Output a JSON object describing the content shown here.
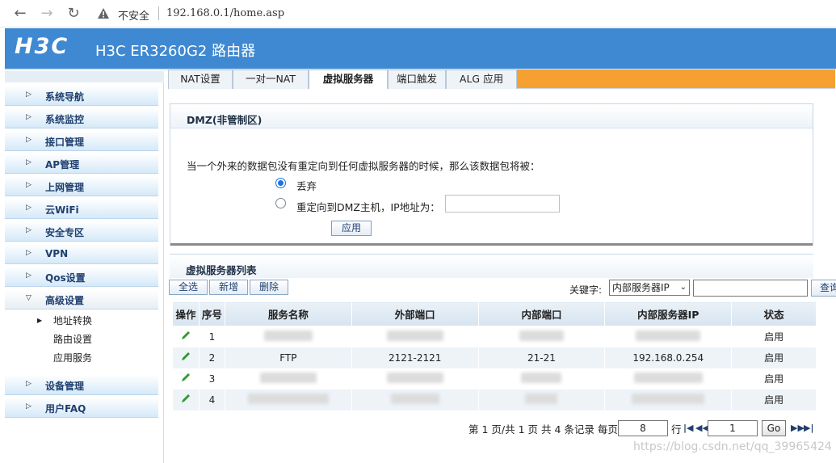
{
  "browser": {
    "back_icon": "back-arrow-icon",
    "forward_icon": "forward-arrow-icon",
    "reload_icon": "reload-icon",
    "insecure_label": "不安全",
    "url": "192.168.0.1/home.asp"
  },
  "header": {
    "logo": "H3C",
    "model": "H3C ER3260G2 路由器",
    "color": "#3f89d2"
  },
  "sidebar": {
    "items": [
      {
        "label": "系统导航"
      },
      {
        "label": "系统监控"
      },
      {
        "label": "接口管理"
      },
      {
        "label": "AP管理"
      },
      {
        "label": "上网管理"
      },
      {
        "label": "云WiFi"
      },
      {
        "label": "安全专区"
      },
      {
        "label": "VPN"
      },
      {
        "label": "Qos设置"
      },
      {
        "label": "高级设置"
      },
      {
        "label": "设备管理"
      },
      {
        "label": "用户FAQ"
      }
    ],
    "sub_items": [
      {
        "label": "地址转换"
      },
      {
        "label": "路由设置"
      },
      {
        "label": "应用服务"
      }
    ]
  },
  "tabs": [
    {
      "label": "NAT设置"
    },
    {
      "label": "一对一NAT"
    },
    {
      "label": "虚拟服务器"
    },
    {
      "label": "端口触发"
    },
    {
      "label": "ALG 应用"
    }
  ],
  "dmz": {
    "title": "DMZ(非管制区)",
    "description": "当一个外来的数据包没有重定向到任何虚拟服务器的时候，那么该数据包将被：",
    "option_drop": "丢弃",
    "option_redirect": "重定向到DMZ主机，IP地址为：",
    "ip_value": "",
    "apply_label": "应用"
  },
  "list": {
    "title": "虚拟服务器列表",
    "select_all": "全选",
    "add": "新增",
    "delete": "删除",
    "keyword_label": "关键字:",
    "keyword_option": "内部服务器IP",
    "keyword_value": "",
    "search_label": "查询",
    "columns": [
      "操作",
      "序号",
      "服务名称",
      "外部端口",
      "内部端口",
      "内部服务器IP",
      "状态"
    ],
    "rows": [
      {
        "no": "1",
        "name": "",
        "ext": "",
        "int": "",
        "ip": "",
        "status": "启用"
      },
      {
        "no": "2",
        "name": "FTP",
        "ext": "2121-2121",
        "int": "21-21",
        "ip": "192.168.0.254",
        "status": "启用"
      },
      {
        "no": "3",
        "name": "",
        "ext": "",
        "int": "",
        "ip": "",
        "status": "启用"
      },
      {
        "no": "4",
        "name": "",
        "ext": "",
        "int": "",
        "ip": "",
        "status": "启用"
      }
    ]
  },
  "pager": {
    "summary": "第 1 页/共 1 页 共 4 条记录 每页",
    "per_page": "8",
    "row_label": "行",
    "page": "1",
    "go_label": "Go"
  },
  "watermark": "https://blog.csdn.net/qq_39965424"
}
